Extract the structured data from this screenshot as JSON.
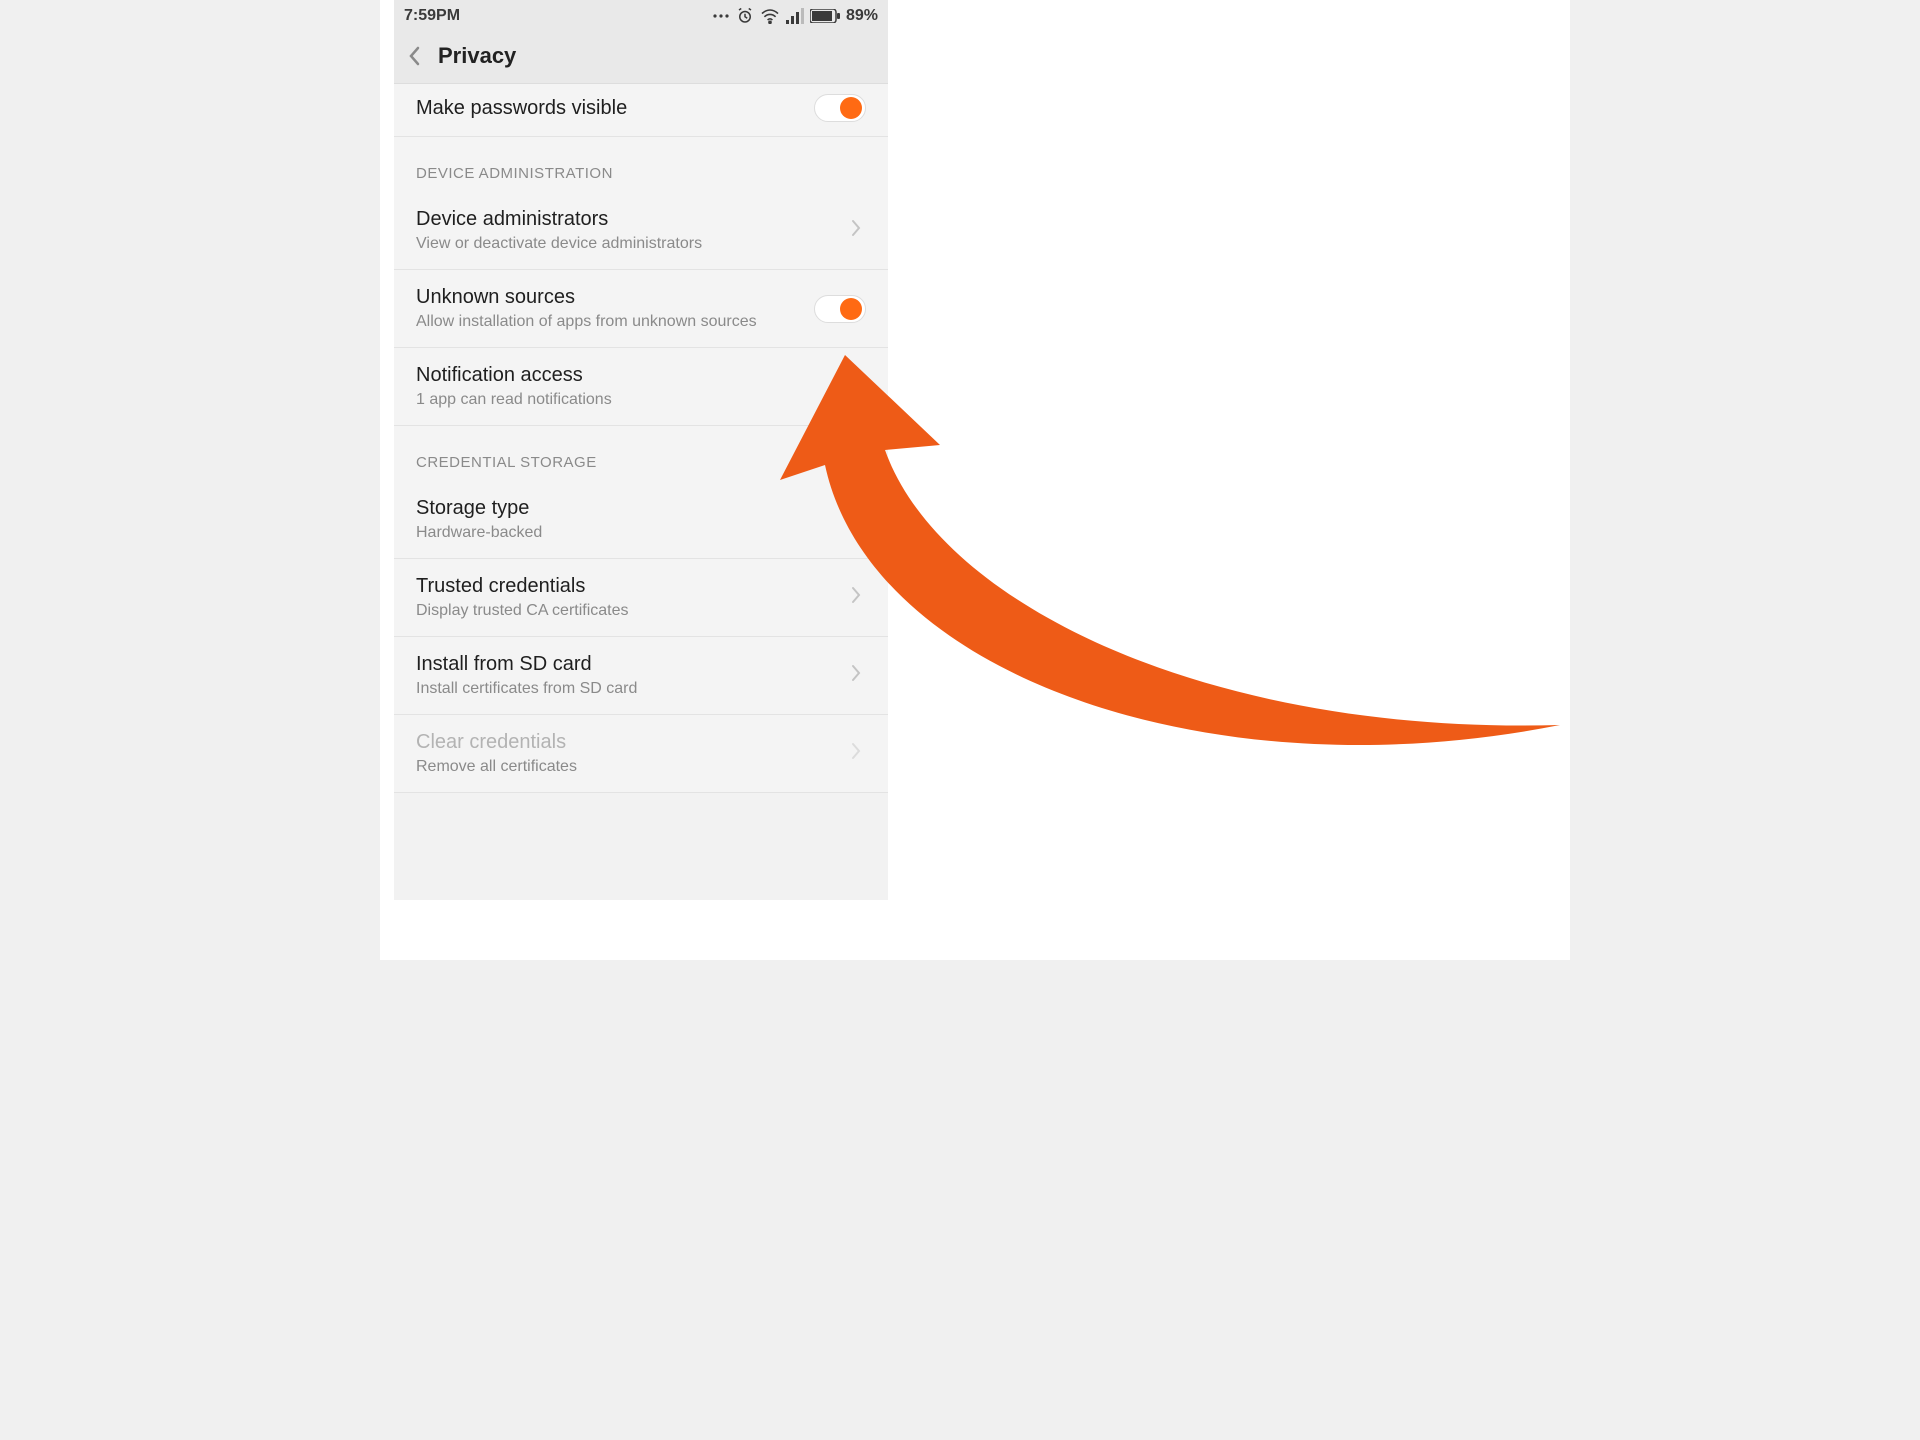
{
  "statusbar": {
    "time": "7:59PM",
    "battery": "89%",
    "icons": {
      "alarm": "alarm-icon",
      "wifi": "wifi-icon",
      "signal": "signal-icon",
      "dots": "more-dots-icon",
      "battery": "battery-icon"
    }
  },
  "header": {
    "title": "Privacy"
  },
  "rows": {
    "make_passwords_visible": {
      "title": "Make passwords visible",
      "toggle_on": true
    }
  },
  "sections": {
    "device_admin": {
      "label": "DEVICE ADMINISTRATION",
      "device_administrators": {
        "title": "Device administrators",
        "sub": "View or deactivate device administrators"
      },
      "unknown_sources": {
        "title": "Unknown sources",
        "sub": "Allow installation of apps from unknown sources",
        "toggle_on": true
      },
      "notification_access": {
        "title": "Notification access",
        "sub": "1 app can read notifications"
      }
    },
    "credential_storage": {
      "label": "CREDENTIAL STORAGE",
      "storage_type": {
        "title": "Storage type",
        "sub": "Hardware-backed"
      },
      "trusted_credentials": {
        "title": "Trusted credentials",
        "sub": "Display trusted CA certificates"
      },
      "install_sd": {
        "title": "Install from SD card",
        "sub": "Install certificates from SD card"
      },
      "clear_credentials": {
        "title": "Clear credentials",
        "sub": "Remove all certificates",
        "disabled": true
      }
    }
  },
  "annotation": {
    "arrow_color": "#ee5b17",
    "target": "unknown-sources-toggle"
  }
}
